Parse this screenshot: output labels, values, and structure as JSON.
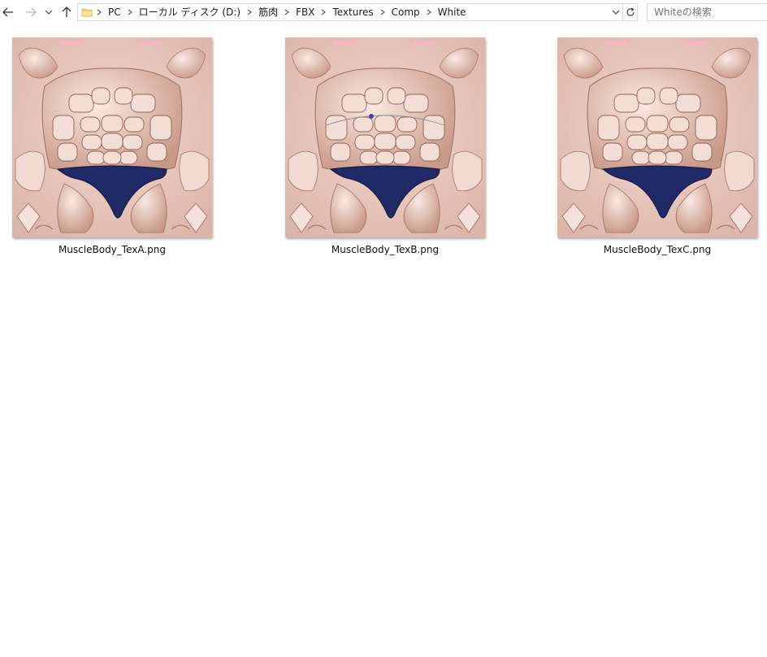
{
  "nav": {
    "back_icon": "arrow-left-icon",
    "forward_icon": "arrow-right-icon",
    "recent_icon": "chevron-down-icon",
    "up_icon": "arrow-up-icon"
  },
  "address": {
    "crumbs": [
      "PC",
      "ローカル ディスク (D:)",
      "筋肉",
      "FBX",
      "Textures",
      "Comp",
      "White"
    ],
    "folder_icon": "folder-icon",
    "dropdown_icon": "chevron-down-icon",
    "refresh_icon": "refresh-icon"
  },
  "search": {
    "placeholder": "Whiteの検索"
  },
  "files": [
    {
      "name": "MuscleBody_TexA.png",
      "variant": "A"
    },
    {
      "name": "MuscleBody_TexB.png",
      "variant": "B"
    },
    {
      "name": "MuscleBody_TexC.png",
      "variant": "C"
    }
  ],
  "colors": {
    "thumb_bg": "#e9cbc2",
    "skin": "#dcb3a4",
    "shorts": "#1f2a66"
  }
}
